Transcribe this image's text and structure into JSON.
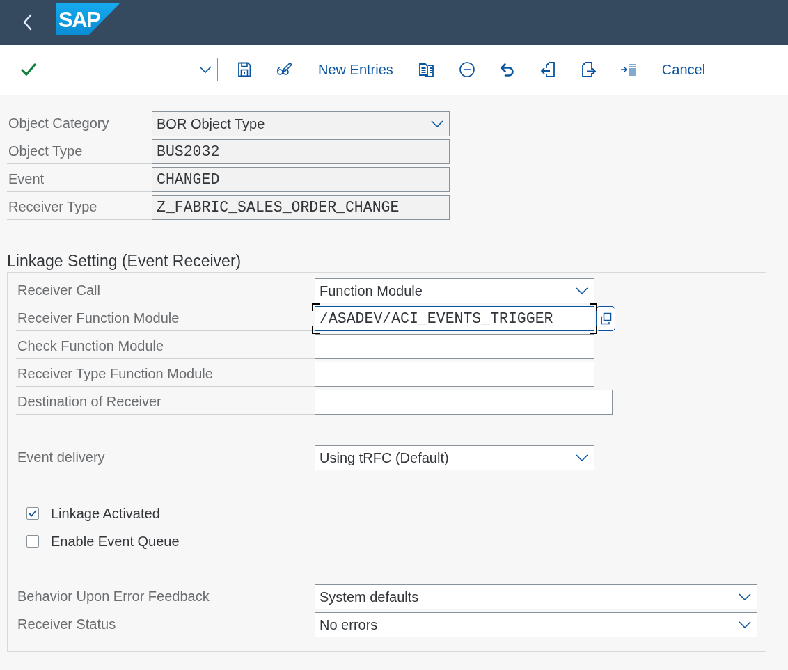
{
  "shell": {
    "logo": "SAP"
  },
  "toolbar": {
    "buttons": [
      {
        "label": "New Entries"
      },
      {
        "label": "Cancel"
      }
    ]
  },
  "header_fields": [
    {
      "kind": "dropdown",
      "label": "Object Category",
      "value": "BOR Object Type",
      "read_only": true
    },
    {
      "kind": "input",
      "label": "Object Type",
      "value": "BUS2032",
      "read_only": true
    },
    {
      "kind": "input",
      "label": "Event",
      "value": "CHANGED",
      "read_only": true
    },
    {
      "kind": "input",
      "label": "Receiver Type",
      "value": "Z_FABRIC_SALES_ORDER_CHANGE",
      "read_only": true
    }
  ],
  "linkage": {
    "title": "Linkage Setting (Event Receiver)",
    "groups": [
      {
        "rows": [
          {
            "kind": "dropdown",
            "label": "Receiver Call",
            "value": "Function Module",
            "read_only": false,
            "focused": false
          },
          {
            "kind": "input",
            "label": "Receiver Function Module",
            "value": "/ASADEV/ACI_EVENTS_TRIGGER",
            "read_only": false,
            "focused": true
          },
          {
            "kind": "input",
            "label": "Check Function Module",
            "read_only": false,
            "focused": false
          },
          {
            "kind": "input",
            "label": "Receiver Type Function Module",
            "read_only": false,
            "focused": false
          },
          {
            "kind": "input",
            "label": "Destination of Receiver",
            "read_only": false,
            "focused": false
          }
        ]
      },
      {
        "rows": [
          {
            "kind": "dropdown",
            "label": "Event delivery",
            "value": "Using tRFC (Default)",
            "read_only": false,
            "focused": false
          }
        ]
      },
      {
        "rows": [
          {
            "kind": "checkbox",
            "label": "Linkage Activated",
            "checked": true
          },
          {
            "kind": "checkbox",
            "label": "Enable Event Queue",
            "checked": false
          }
        ]
      },
      {
        "rows": [
          {
            "kind": "dropdown",
            "label": "Behavior Upon Error Feedback",
            "value": "System defaults",
            "read_only": false,
            "focused": false
          },
          {
            "kind": "dropdown",
            "label": "Receiver Status",
            "value": "No errors",
            "read_only": false,
            "focused": false
          }
        ]
      }
    ]
  }
}
